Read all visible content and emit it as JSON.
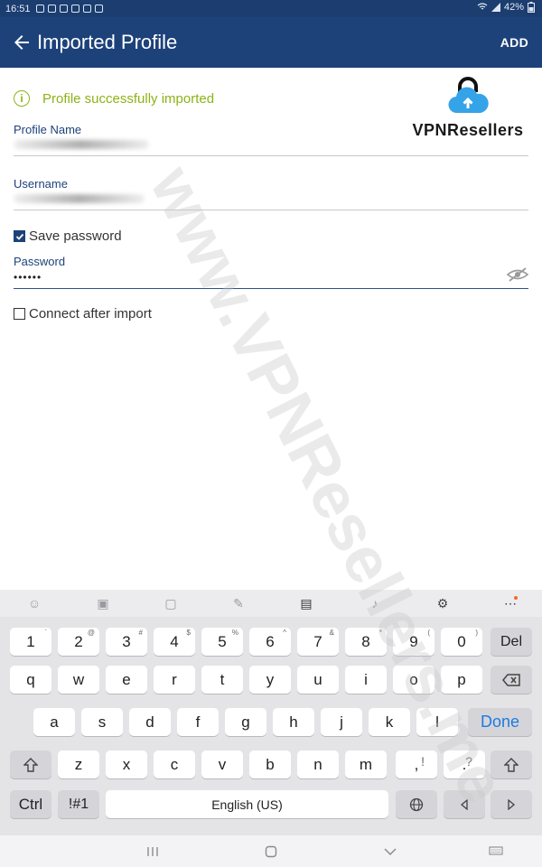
{
  "status_bar": {
    "time": "16:51",
    "battery": "42%"
  },
  "app_bar": {
    "title": "Imported Profile",
    "add_label": "ADD"
  },
  "alert": {
    "message": "Profile successfully imported"
  },
  "logo": {
    "text": "VPNResellers"
  },
  "form": {
    "profile_name_label": "Profile Name",
    "username_label": "Username",
    "save_password_label": "Save password",
    "save_password_checked": true,
    "password_label": "Password",
    "password_value": "••••••",
    "connect_after_import_label": "Connect after import",
    "connect_after_import_checked": false
  },
  "watermark": {
    "text": "www.VPNResellers.me"
  },
  "keyboard": {
    "row_numbers": [
      {
        "k": "1",
        "s": "`"
      },
      {
        "k": "2",
        "s": "@"
      },
      {
        "k": "3",
        "s": "#"
      },
      {
        "k": "4",
        "s": "$"
      },
      {
        "k": "5",
        "s": "%"
      },
      {
        "k": "6",
        "s": "^"
      },
      {
        "k": "7",
        "s": "&"
      },
      {
        "k": "8",
        "s": "*"
      },
      {
        "k": "9",
        "s": "("
      },
      {
        "k": "0",
        "s": ")"
      }
    ],
    "del_label": "Del",
    "row_q": [
      "q",
      "w",
      "e",
      "r",
      "t",
      "y",
      "u",
      "i",
      "o",
      "p"
    ],
    "row_a": [
      "a",
      "s",
      "d",
      "f",
      "g",
      "h",
      "j",
      "k",
      "l"
    ],
    "done_label": "Done",
    "row_z": [
      "z",
      "x",
      "c",
      "v",
      "b",
      "n",
      "m"
    ],
    "comma": {
      "k": ",",
      "s": "!"
    },
    "period": {
      "k": ".",
      "s": "?"
    },
    "ctrl_label": "Ctrl",
    "symbols_label": "!#1",
    "space_label": "English (US)"
  },
  "colors": {
    "app_bar": "#1d427a",
    "success": "#8cb316",
    "done": "#1f7ae0"
  }
}
